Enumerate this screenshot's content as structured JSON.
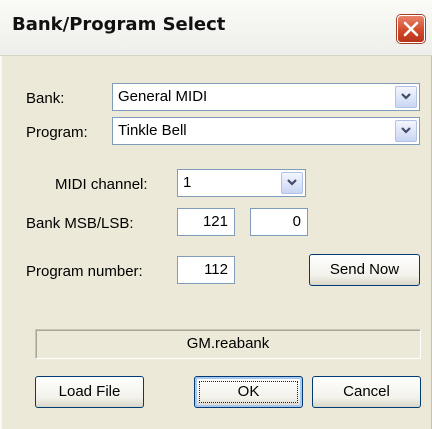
{
  "window": {
    "title": "Bank/Program Select",
    "close_icon": "close-icon",
    "accent_close": "#d24a2a"
  },
  "form": {
    "bank_label": "Bank:",
    "bank_value": "General MIDI",
    "program_label": "Program:",
    "program_value": "Tinkle Bell",
    "midi_channel_label": "MIDI channel:",
    "midi_channel_value": "1",
    "bank_msb_lsb_label": "Bank MSB/LSB:",
    "bank_msb_value": "121",
    "bank_lsb_value": "0",
    "program_number_label": "Program number:",
    "program_number_value": "112"
  },
  "buttons": {
    "send_now": "Send Now",
    "load_file": "Load File",
    "ok": "OK",
    "cancel": "Cancel"
  },
  "status": {
    "bank_file": "GM.reabank"
  }
}
